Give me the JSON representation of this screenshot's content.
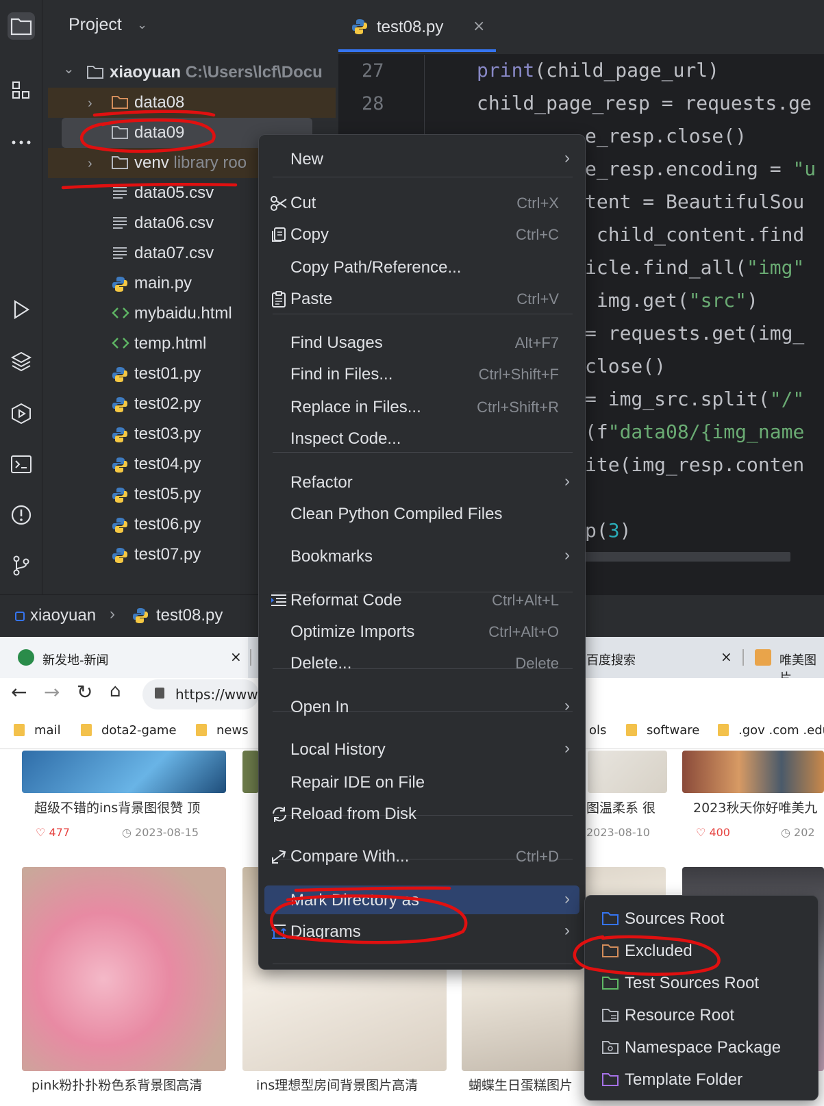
{
  "ide": {
    "panel_title": "Project",
    "tree": [
      {
        "label": "xiaoyuan",
        "hint": "C:\\Users\\lcf\\Docu",
        "type": "folder",
        "indent": 0,
        "expanded": true
      },
      {
        "label": "data08",
        "hint": "",
        "type": "folder-excluded",
        "indent": 1,
        "expanded": false
      },
      {
        "label": "data09",
        "hint": "",
        "type": "folder",
        "indent": 1,
        "selected": true
      },
      {
        "label": "venv",
        "hint": "library roo",
        "type": "folder",
        "indent": 1,
        "expanded": false
      },
      {
        "label": "data05.csv",
        "hint": "",
        "type": "text",
        "indent": 1
      },
      {
        "label": "data06.csv",
        "hint": "",
        "type": "text",
        "indent": 1
      },
      {
        "label": "data07.csv",
        "hint": "",
        "type": "text",
        "indent": 1
      },
      {
        "label": "main.py",
        "hint": "",
        "type": "python",
        "indent": 1
      },
      {
        "label": "mybaidu.html",
        "hint": "",
        "type": "html",
        "indent": 1
      },
      {
        "label": "temp.html",
        "hint": "",
        "type": "html",
        "indent": 1
      },
      {
        "label": "test01.py",
        "hint": "",
        "type": "python",
        "indent": 1
      },
      {
        "label": "test02.py",
        "hint": "",
        "type": "python",
        "indent": 1
      },
      {
        "label": "test03.py",
        "hint": "",
        "type": "python",
        "indent": 1
      },
      {
        "label": "test04.py",
        "hint": "",
        "type": "python",
        "indent": 1
      },
      {
        "label": "test05.py",
        "hint": "",
        "type": "python",
        "indent": 1
      },
      {
        "label": "test06.py",
        "hint": "",
        "type": "python",
        "indent": 1
      },
      {
        "label": "test07.py",
        "hint": "",
        "type": "python",
        "indent": 1
      }
    ],
    "editor_tab": "test08.py",
    "line_numbers": [
      "27",
      "28"
    ],
    "code_lines": [
      {
        "text": "print(child_page_url)"
      },
      {
        "text": "child_page_resp = requests.ge"
      },
      {
        "text": "e_resp.close()"
      },
      {
        "text": "e_resp.encoding = \"u"
      },
      {
        "text": "tent = BeautifulSou"
      },
      {
        "text": " child_content.find"
      },
      {
        "text": "icle.find_all(\"img\""
      },
      {
        "text": " img.get(\"src\")"
      },
      {
        "text": "= requests.get(img_"
      },
      {
        "text": "close()"
      },
      {
        "text": "= img_src.split(\"/\""
      },
      {
        "text": "(f\"data08/{img_name"
      },
      {
        "text": "ite(img_resp.conten"
      },
      {
        "text": ""
      },
      {
        "text": "p(3)"
      }
    ],
    "breadcrumbs": [
      "xiaoyuan",
      "test08.py"
    ]
  },
  "browser": {
    "tabs": [
      {
        "title": "新发地-新闻"
      },
      {
        "title": "百度搜索"
      },
      {
        "title": "唯美图片"
      }
    ],
    "url": "https://www",
    "bookmarks": [
      "mail",
      "dota2-game",
      "news",
      "ols",
      "software",
      ".gov .com .edu"
    ],
    "cards_top": [
      {
        "caption": "超级不错的ins背景图很赞 顶",
        "likes": "477",
        "date": "2023-08-15"
      },
      {
        "caption": "图温柔系 很",
        "likes": "",
        "date": "2023-08-10"
      },
      {
        "caption": "2023秋天你好唯美九",
        "likes": "400",
        "date": "202"
      }
    ],
    "cards_bottom": [
      {
        "caption": "pink粉扑扑粉色系背景图高清"
      },
      {
        "caption": "ins理想型房间背景图片高清"
      },
      {
        "caption": "蝴蝶生日蛋糕图片"
      }
    ]
  },
  "context_menu": {
    "items": [
      {
        "label": "New",
        "shortcut": "",
        "submenu": true,
        "icon": ""
      },
      {
        "label": "Cut",
        "shortcut": "Ctrl+X",
        "icon": "scissors-icon"
      },
      {
        "label": "Copy",
        "shortcut": "Ctrl+C",
        "icon": "copy-icon"
      },
      {
        "label": "Copy Path/Reference...",
        "shortcut": "",
        "icon": ""
      },
      {
        "label": "Paste",
        "shortcut": "Ctrl+V",
        "icon": "paste-icon"
      },
      {
        "label": "Find Usages",
        "shortcut": "Alt+F7",
        "icon": ""
      },
      {
        "label": "Find in Files...",
        "shortcut": "Ctrl+Shift+F",
        "icon": ""
      },
      {
        "label": "Replace in Files...",
        "shortcut": "Ctrl+Shift+R",
        "icon": ""
      },
      {
        "label": "Inspect Code...",
        "shortcut": "",
        "icon": ""
      },
      {
        "label": "Refactor",
        "shortcut": "",
        "submenu": true,
        "icon": ""
      },
      {
        "label": "Clean Python Compiled Files",
        "shortcut": "",
        "icon": ""
      },
      {
        "label": "Bookmarks",
        "shortcut": "",
        "submenu": true,
        "icon": ""
      },
      {
        "label": "Reformat Code",
        "shortcut": "Ctrl+Alt+L",
        "icon": "reformat-icon"
      },
      {
        "label": "Optimize Imports",
        "shortcut": "Ctrl+Alt+O",
        "icon": ""
      },
      {
        "label": "Delete...",
        "shortcut": "Delete",
        "icon": ""
      },
      {
        "label": "Open In",
        "shortcut": "",
        "submenu": true,
        "icon": ""
      },
      {
        "label": "Local History",
        "shortcut": "",
        "submenu": true,
        "icon": ""
      },
      {
        "label": "Repair IDE on File",
        "shortcut": "",
        "icon": ""
      },
      {
        "label": "Reload from Disk",
        "shortcut": "",
        "icon": "reload-icon"
      },
      {
        "label": "Compare With...",
        "shortcut": "Ctrl+D",
        "icon": "compare-icon"
      },
      {
        "label": "Mark Directory as",
        "shortcut": "",
        "submenu": true,
        "highlighted": true,
        "icon": ""
      },
      {
        "label": "Diagrams",
        "shortcut": "",
        "submenu": true,
        "icon": "diagram-icon"
      }
    ]
  },
  "submenu": {
    "items": [
      {
        "label": "Sources Root",
        "color": "#3574f0"
      },
      {
        "label": "Excluded",
        "color": "#d38d5b"
      },
      {
        "label": "Test Sources Root",
        "color": "#5fb865"
      },
      {
        "label": "Resource Root",
        "color": "#b4b8bf"
      },
      {
        "label": "Namespace Package",
        "color": "#b4b8bf"
      },
      {
        "label": "Template Folder",
        "color": "#a571e6"
      }
    ]
  },
  "colors": {
    "annotation": "#e01010",
    "highlight": "#2e436e",
    "accent": "#3574f0"
  }
}
